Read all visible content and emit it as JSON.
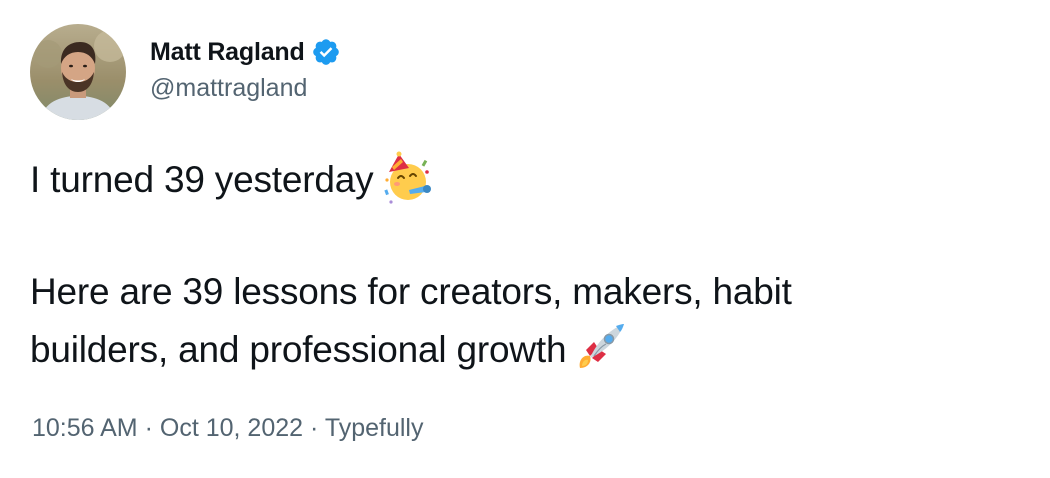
{
  "author": {
    "display_name": "Matt Ragland",
    "handle": "@mattragland",
    "verified": true,
    "avatar_icon": "avatar-photo",
    "verified_color": "#1d9bf0"
  },
  "tweet": {
    "line1": "I turned 39 yesterday",
    "line1_emoji": "partying-face",
    "line2": "Here are 39 lessons for creators, makers, habit",
    "line3": "builders, and professional growth",
    "line3_emoji": "rocket"
  },
  "meta": {
    "time": "10:56 AM",
    "separator": "·",
    "date": "Oct 10, 2022",
    "source": "Typefully"
  },
  "colors": {
    "text": "#0f1419",
    "secondary": "#536471",
    "background": "#ffffff"
  }
}
